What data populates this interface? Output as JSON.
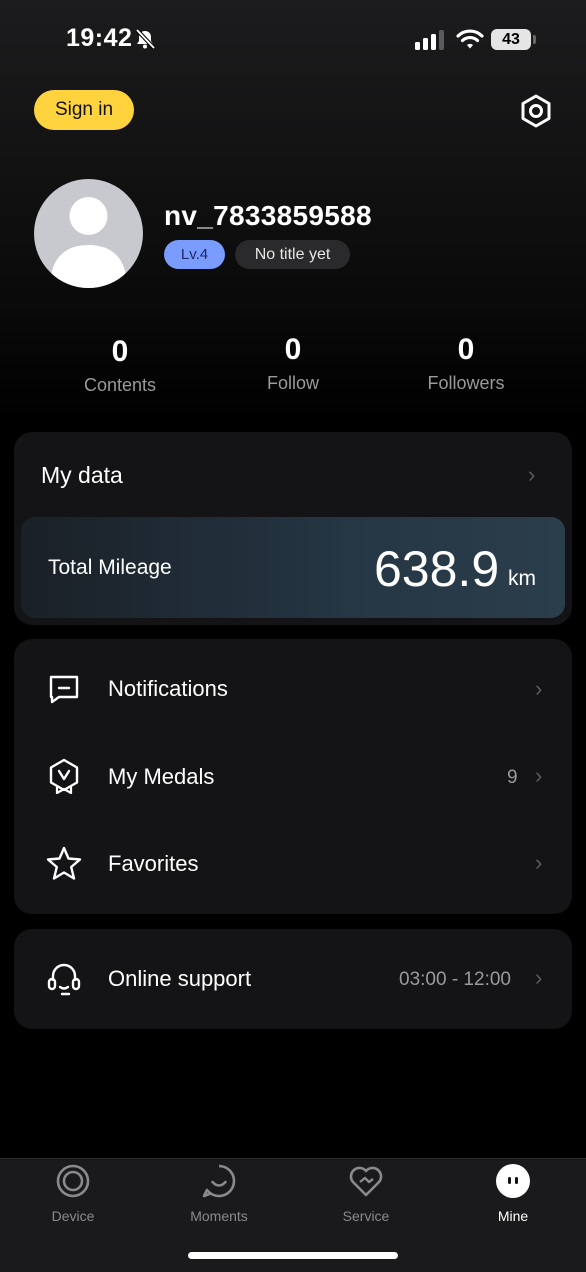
{
  "status_bar": {
    "time": "19:42",
    "battery": "43"
  },
  "header": {
    "signin_label": "Sign in"
  },
  "profile": {
    "username": "nv_7833859588",
    "level": "Lv.4",
    "title": "No title yet"
  },
  "stats": [
    {
      "value": "0",
      "label": "Contents"
    },
    {
      "value": "0",
      "label": "Follow"
    },
    {
      "value": "0",
      "label": "Followers"
    }
  ],
  "my_data": {
    "title": "My data",
    "mileage_label": "Total Mileage",
    "mileage_value": "638.9",
    "mileage_unit": "km"
  },
  "menu": [
    {
      "label": "Notifications",
      "icon": "message-icon",
      "meta": ""
    },
    {
      "label": "My Medals",
      "icon": "medal-icon",
      "meta": "9"
    },
    {
      "label": "Favorites",
      "icon": "star-icon",
      "meta": ""
    }
  ],
  "support": {
    "label": "Online support",
    "hours": "03:00 - 12:00",
    "icon": "headset-icon"
  },
  "tabs": [
    {
      "label": "Device",
      "icon": "device-icon"
    },
    {
      "label": "Moments",
      "icon": "moments-icon"
    },
    {
      "label": "Service",
      "icon": "service-icon"
    },
    {
      "label": "Mine",
      "icon": "mine-icon",
      "active": true
    }
  ],
  "colors": {
    "accent": "#ffd33d",
    "level_chip": "#7b9cff",
    "background": "#000000",
    "card": "#141416"
  }
}
